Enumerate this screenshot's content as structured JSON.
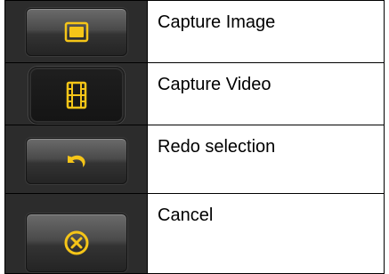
{
  "rows": [
    {
      "label": "Capture Image",
      "icon": "capture-image-icon"
    },
    {
      "label": "Capture Video",
      "icon": "film-strip-icon"
    },
    {
      "label": "Redo selection",
      "icon": "undo-arrow-icon"
    },
    {
      "label": "Cancel",
      "icon": "cancel-circle-x-icon"
    }
  ],
  "colors": {
    "icon_accent": "#f5c518",
    "button_dark": "#2c2c2c"
  }
}
